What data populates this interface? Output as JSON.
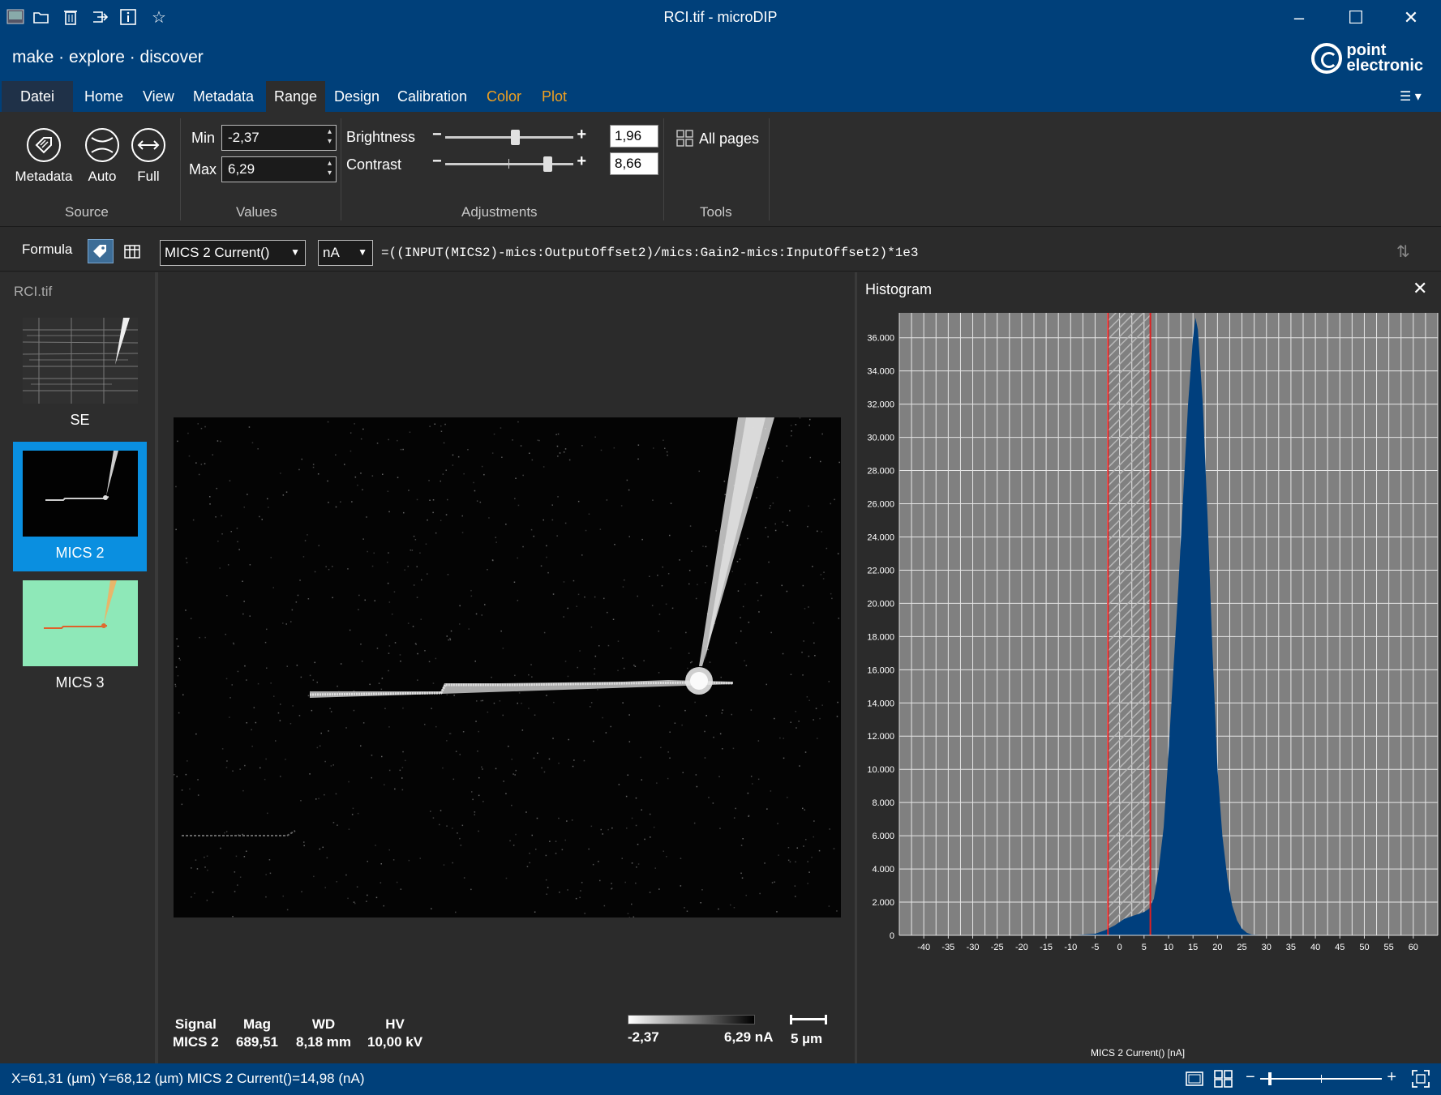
{
  "window": {
    "title": "RCI.tif - microDIP",
    "tagline": "make · explore · discover",
    "logo_line1": "point",
    "logo_line2": "electronic"
  },
  "menu": {
    "file": "Datei",
    "tabs": [
      "Home",
      "View",
      "Metadata",
      "Range",
      "Design",
      "Calibration",
      "Color",
      "Plot"
    ],
    "active": "Range"
  },
  "ribbon": {
    "source_buttons": [
      "Metadata",
      "Auto",
      "Full"
    ],
    "source_label": "Source",
    "min_label": "Min",
    "min_value": "-2,37",
    "max_label": "Max",
    "max_value": "6,29",
    "values_label": "Values",
    "brightness_label": "Brightness",
    "brightness_value": "1,96",
    "contrast_label": "Contrast",
    "contrast_value": "8,66",
    "adjustments_label": "Adjustments",
    "all_pages_label": "All pages",
    "tools_label": "Tools"
  },
  "formula_bar": {
    "label": "Formula",
    "signal_select": "MICS 2 Current()",
    "unit_select": "nA",
    "formula": "=((INPUT(MICS2)-mics:OutputOffset2)/mics:Gain2-mics:InputOffset2)*1e3"
  },
  "sidebar": {
    "file_name": "RCI.tif",
    "items": [
      {
        "label": "SE",
        "selected": false
      },
      {
        "label": "MICS 2",
        "selected": true
      },
      {
        "label": "MICS 3",
        "selected": false
      }
    ]
  },
  "image_info": {
    "signal_header": "Signal",
    "signal_value": "MICS 2",
    "mag_header": "Mag",
    "mag_value": "689,51",
    "wd_header": "WD",
    "wd_value": "8,18 mm",
    "hv_header": "HV",
    "hv_value": "10,00 kV",
    "colorbar_min": "-2,37",
    "colorbar_max": "6,29 nA",
    "scalebar_label": "5 µm"
  },
  "histogram": {
    "title": "Histogram",
    "colors": {
      "plot_bg": "#808080",
      "bars": "#003f7d",
      "range_lines": "#e02020"
    }
  },
  "chart_data": {
    "type": "area",
    "title": "",
    "xlabel": "MICS 2 Current() [nA]",
    "ylabel": "",
    "xlim": [
      -45,
      65
    ],
    "ylim": [
      0,
      37500
    ],
    "xticks": [
      -40,
      -35,
      -30,
      -25,
      -20,
      -15,
      -10,
      -5,
      0,
      5,
      10,
      15,
      20,
      25,
      30,
      35,
      40,
      45,
      50,
      55,
      60
    ],
    "yticks": [
      0,
      2000,
      4000,
      6000,
      8000,
      10000,
      12000,
      14000,
      16000,
      18000,
      20000,
      22000,
      24000,
      26000,
      28000,
      30000,
      32000,
      34000,
      36000
    ],
    "ytick_labels": [
      "0",
      "2.000",
      "4.000",
      "6.000",
      "8.000",
      "10.000",
      "12.000",
      "14.000",
      "16.000",
      "18.000",
      "20.000",
      "22.000",
      "24.000",
      "26.000",
      "28.000",
      "30.000",
      "32.000",
      "34.000",
      "36.000"
    ],
    "grid": true,
    "selected_range": [
      -2.37,
      6.29
    ],
    "series": [
      {
        "x": [
          -10,
          -5,
          -3,
          -1,
          0,
          1,
          2,
          3,
          4,
          5,
          6,
          7,
          8,
          9,
          10,
          11,
          12,
          13,
          14,
          15,
          15.5,
          16,
          17,
          18,
          19,
          20,
          21,
          22,
          23,
          24,
          25,
          26,
          27,
          30
        ],
        "values": [
          0,
          100,
          300,
          600,
          800,
          1000,
          1100,
          1200,
          1300,
          1400,
          1600,
          2200,
          4000,
          6500,
          11000,
          16000,
          21000,
          26500,
          32000,
          36000,
          37200,
          36500,
          32000,
          25000,
          17000,
          10000,
          6000,
          3500,
          1800,
          900,
          400,
          150,
          50,
          0
        ]
      }
    ]
  },
  "status": {
    "text": "X=61,31 (µm)  Y=68,12 (µm)  MICS 2 Current()=14,98 (nA)"
  }
}
